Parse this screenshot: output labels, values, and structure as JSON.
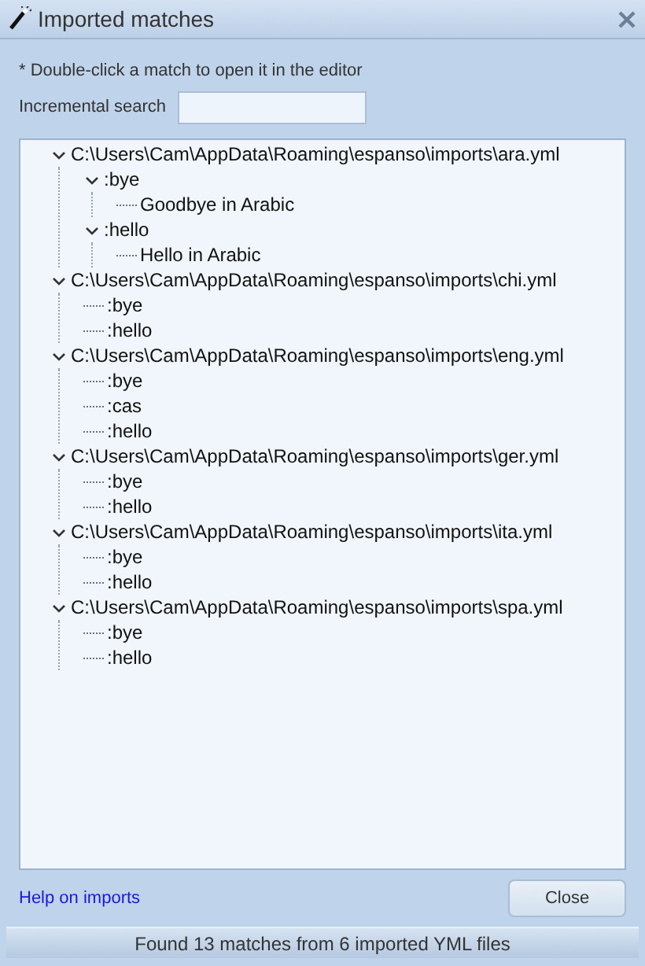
{
  "window": {
    "title": "Imported matches"
  },
  "hint": "* Double-click a match to open it in the editor",
  "search": {
    "label": "Incremental search"
  },
  "tree": [
    {
      "label": "C:\\Users\\Cam\\AppData\\Roaming\\espanso\\imports\\ara.yml",
      "expanded": true,
      "children": [
        {
          "label": ":bye",
          "expanded": true,
          "children": [
            {
              "label": "Goodbye in Arabic"
            }
          ]
        },
        {
          "label": ":hello",
          "expanded": true,
          "children": [
            {
              "label": "Hello in Arabic"
            }
          ]
        }
      ]
    },
    {
      "label": "C:\\Users\\Cam\\AppData\\Roaming\\espanso\\imports\\chi.yml",
      "expanded": true,
      "children": [
        {
          "label": ":bye"
        },
        {
          "label": ":hello"
        }
      ]
    },
    {
      "label": "C:\\Users\\Cam\\AppData\\Roaming\\espanso\\imports\\eng.yml",
      "expanded": true,
      "children": [
        {
          "label": ":bye"
        },
        {
          "label": ":cas"
        },
        {
          "label": ":hello"
        }
      ]
    },
    {
      "label": "C:\\Users\\Cam\\AppData\\Roaming\\espanso\\imports\\ger.yml",
      "expanded": true,
      "children": [
        {
          "label": ":bye"
        },
        {
          "label": ":hello"
        }
      ]
    },
    {
      "label": "C:\\Users\\Cam\\AppData\\Roaming\\espanso\\imports\\ita.yml",
      "expanded": true,
      "children": [
        {
          "label": ":bye"
        },
        {
          "label": ":hello"
        }
      ]
    },
    {
      "label": "C:\\Users\\Cam\\AppData\\Roaming\\espanso\\imports\\spa.yml",
      "expanded": true,
      "children": [
        {
          "label": ":bye"
        },
        {
          "label": ":hello"
        }
      ]
    }
  ],
  "help_link": "Help on imports",
  "close_button": "Close",
  "status_bar": "Found 13 matches from 6 imported YML files"
}
